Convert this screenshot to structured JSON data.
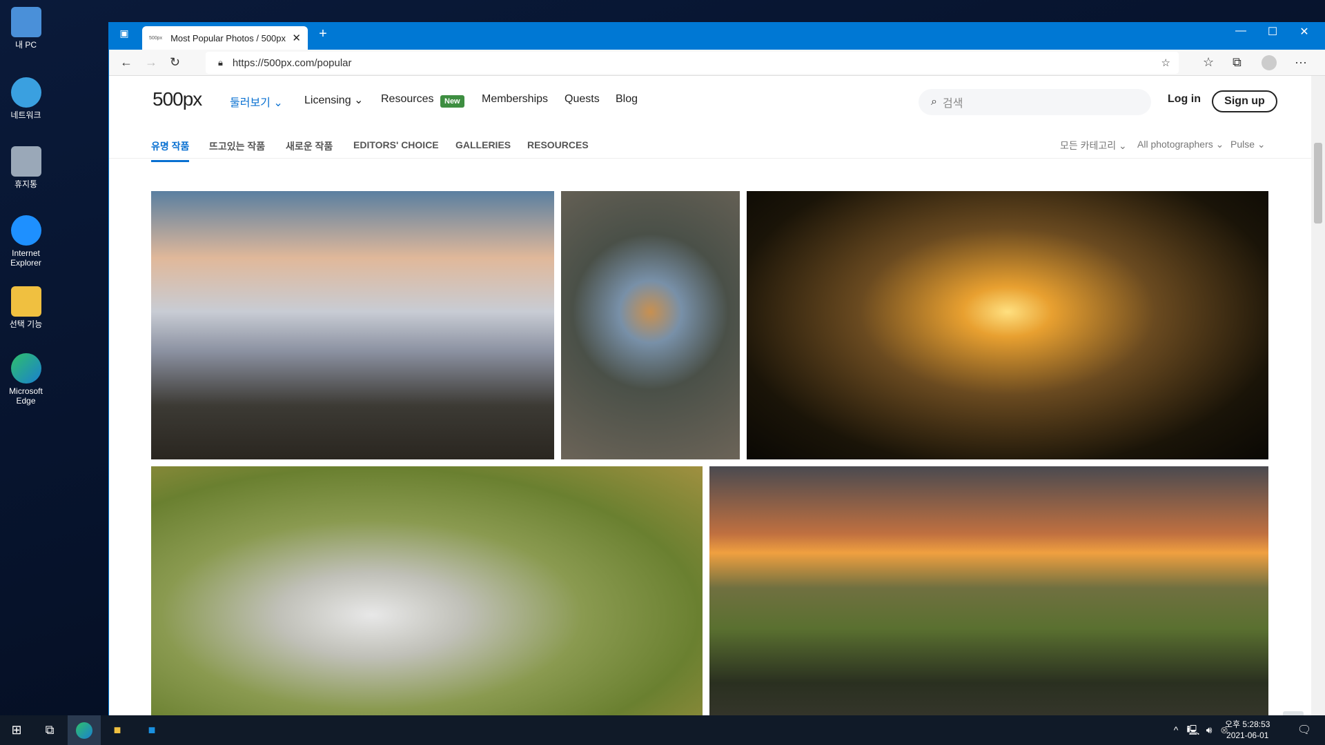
{
  "desktop": {
    "icons": [
      {
        "label": "내 PC",
        "color": "#4a90d9"
      },
      {
        "label": "네트워크",
        "color": "#3aa0e0"
      },
      {
        "label": "휴지통",
        "color": "#9aa8b8"
      },
      {
        "label": "Internet Explorer",
        "color": "#1e90ff"
      },
      {
        "label": "선택 기능",
        "color": "#f0c040"
      },
      {
        "label": "Microsoft Edge",
        "color": "#21a0a0"
      }
    ]
  },
  "browser": {
    "tab_title": "Most Popular Photos / 500px",
    "tab_favicon": "500px",
    "url": "https://500px.com/popular"
  },
  "site": {
    "logo": "500px",
    "nav": [
      "둘러보기",
      "Licensing",
      "Resources",
      "Memberships",
      "Quests",
      "Blog"
    ],
    "badge": "New",
    "search_placeholder": "검색",
    "login": "Log in",
    "signup": "Sign up",
    "tabs": [
      "유명 작품",
      "뜨고있는 작품",
      "새로운 작품",
      "EDITORS' CHOICE",
      "GALLERIES",
      "RESOURCES"
    ],
    "active_tab": 0,
    "filters": [
      "모든 카테고리",
      "All photographers",
      "Pulse"
    ],
    "accent": "#0870d1"
  },
  "photos": [
    {
      "subject": "snowy mountain"
    },
    {
      "subject": "bee-eater bird"
    },
    {
      "subject": "sunset lake boat"
    },
    {
      "subject": "white butterfly on flower"
    },
    {
      "subject": "windmill sunset with swans"
    }
  ],
  "taskbar": {
    "time": "오후 5:28:53",
    "date": "2021-06-01"
  }
}
